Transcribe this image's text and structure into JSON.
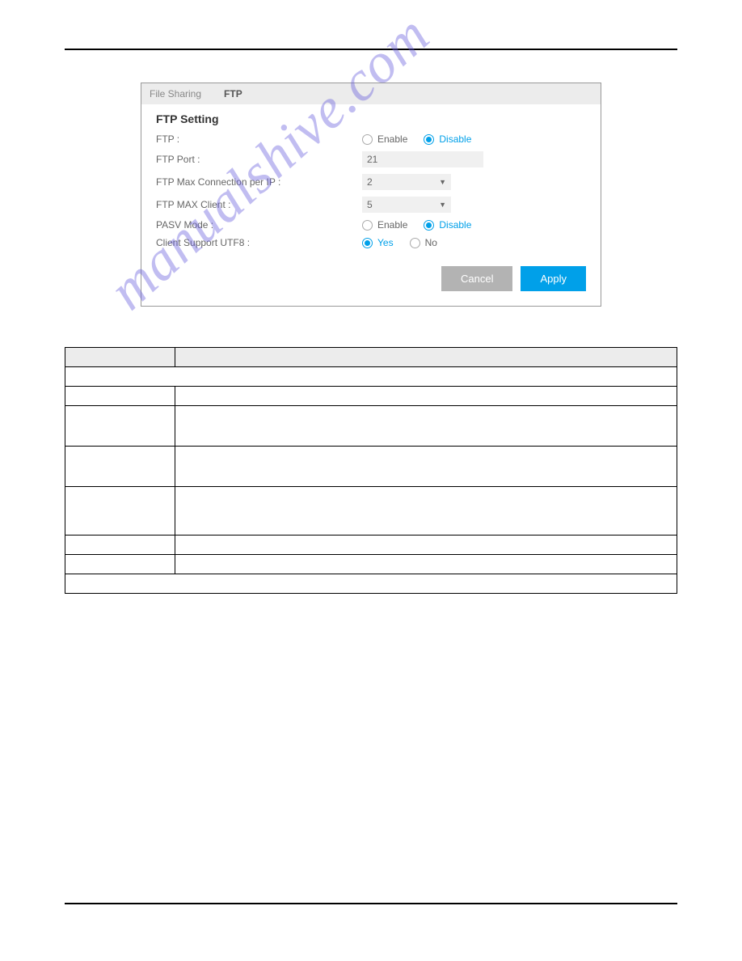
{
  "panel": {
    "tabs": {
      "file_sharing": "File Sharing",
      "ftp": "FTP"
    },
    "title": "FTP Setting",
    "rows": {
      "ftp": {
        "label": "FTP :",
        "opt1": "Enable",
        "opt2": "Disable"
      },
      "port": {
        "label": "FTP Port :",
        "value": "21"
      },
      "maxconn": {
        "label": "FTP Max Connection per IP :",
        "value": "2"
      },
      "maxclient": {
        "label": "FTP MAX Client :",
        "value": "5"
      },
      "pasv": {
        "label": "PASV Mode :",
        "opt1": "Enable",
        "opt2": "Disable"
      },
      "utf8": {
        "label": "Client Support UTF8 :",
        "opt1": "Yes",
        "opt2": "No"
      }
    },
    "buttons": {
      "cancel": "Cancel",
      "apply": "Apply"
    }
  },
  "watermark": "manualshive.com"
}
